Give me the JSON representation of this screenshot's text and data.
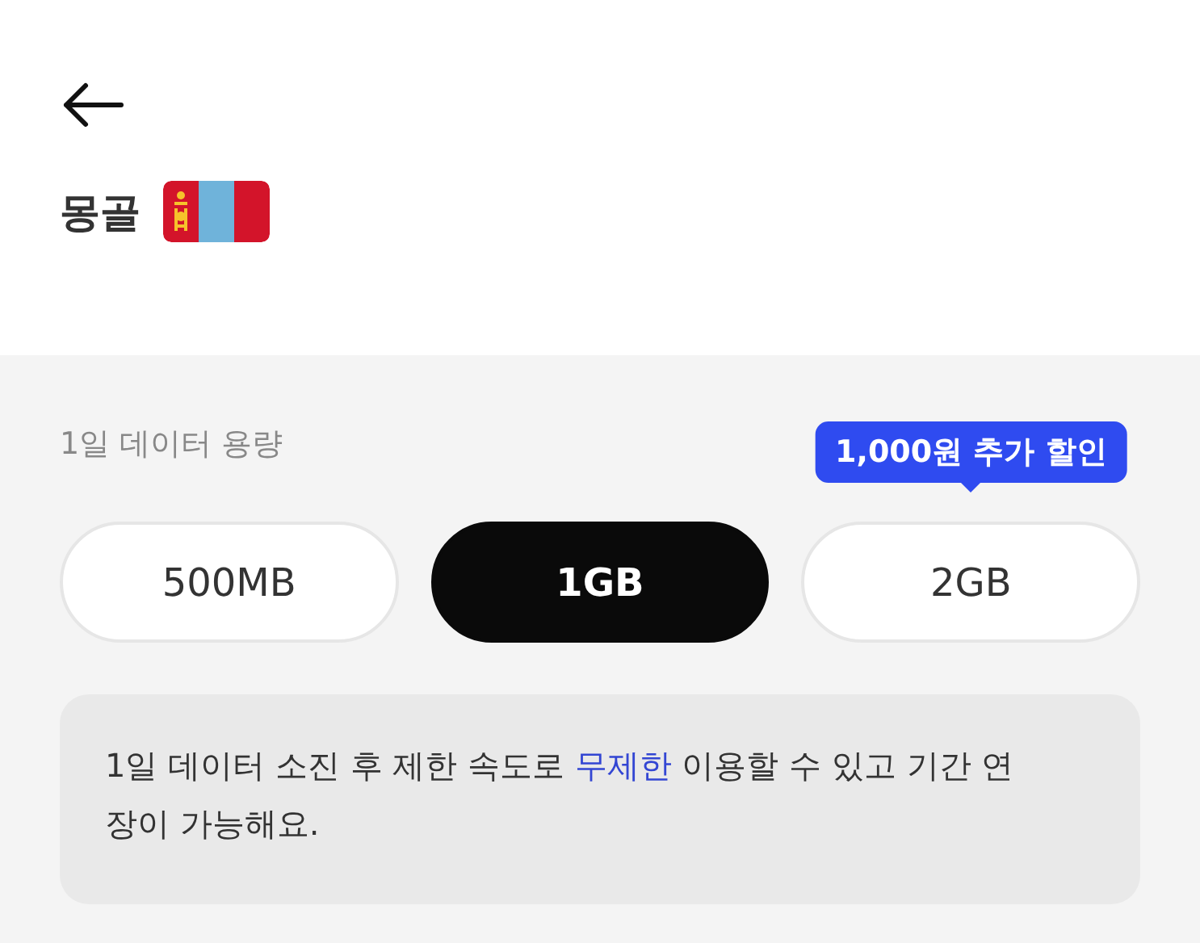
{
  "header": {
    "title": "몽골"
  },
  "data_plan": {
    "label": "1일 데이터 용량",
    "options": [
      {
        "label": "500MB",
        "selected": false
      },
      {
        "label": "1GB",
        "selected": true
      },
      {
        "label": "2GB",
        "selected": false,
        "badge": "1,000원 추가 할인"
      }
    ],
    "note": [
      {
        "kind": "plain",
        "text": "1일 데이터 소진 후 제한 속도로 "
      },
      {
        "kind": "highlight",
        "text": "무제한"
      },
      {
        "kind": "plain",
        "text": " 이용할 수 있고 기간 연장이 가능해요."
      }
    ]
  }
}
